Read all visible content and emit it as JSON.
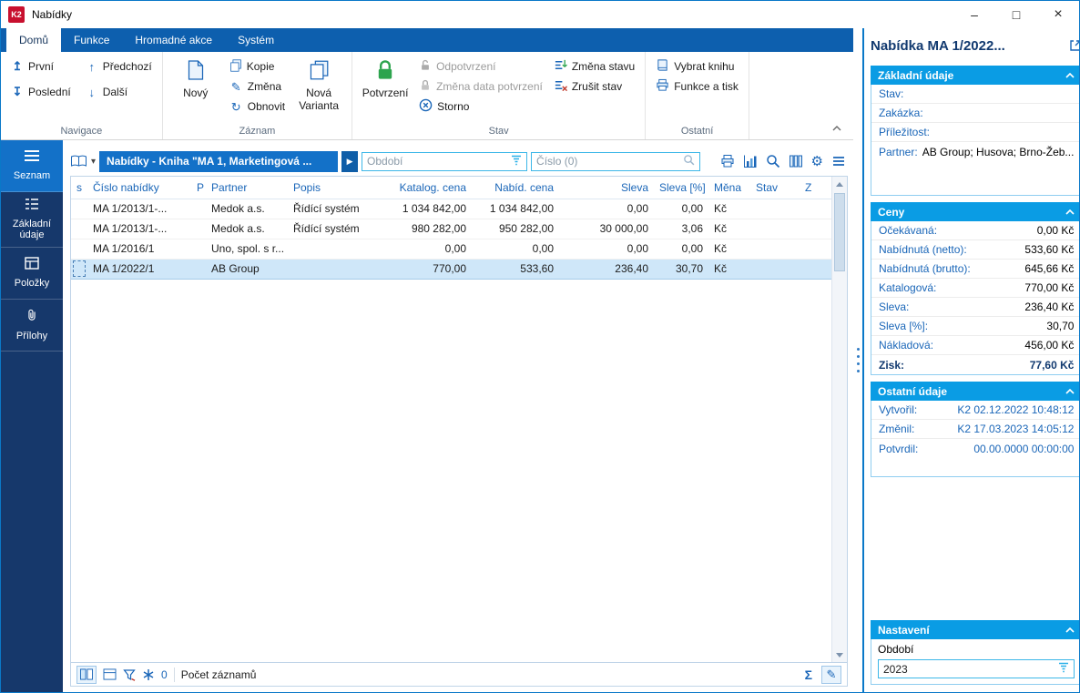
{
  "window": {
    "title": "Nabídky",
    "logo_text": "K2"
  },
  "icons": {
    "minimize": "–",
    "maximize": "□",
    "close": "×",
    "first_arrow": "↥",
    "prev_arrow": "↑",
    "last_arrow": "↧",
    "next_arrow": "↓",
    "refresh": "↻",
    "pencil": "✎",
    "play": "▶",
    "chevron_down": "▾",
    "gear": "⚙",
    "sum": "Σ"
  },
  "ribbon": {
    "tabs": [
      {
        "label": "Domů"
      },
      {
        "label": "Funkce"
      },
      {
        "label": "Hromadné akce"
      },
      {
        "label": "Systém"
      }
    ],
    "groups": {
      "navigace": {
        "label": "Navigace",
        "first": "První",
        "last": "Poslední",
        "prev": "Předchozí",
        "next": "Další"
      },
      "zaznam": {
        "label": "Záznam",
        "new": "Nový",
        "copy": "Kopie",
        "change": "Změna",
        "refresh": "Obnovit",
        "new_variant": "Nová Varianta"
      },
      "stav": {
        "label": "Stav",
        "confirm": "Potvrzení",
        "unconfirm": "Odpotvrzení",
        "change_confirm_date": "Změna data potvrzení",
        "storno": "Storno",
        "change_state": "Změna stavu",
        "cancel_state": "Zrušit stav"
      },
      "ostatni": {
        "label": "Ostatní",
        "select_book": "Vybrat knihu",
        "functions_print": "Funkce a tisk"
      }
    }
  },
  "sidebar": {
    "items": [
      {
        "label": "Seznam"
      },
      {
        "label": "Základní údaje"
      },
      {
        "label": "Položky"
      },
      {
        "label": "Přílohy"
      }
    ]
  },
  "grid": {
    "book_bar_title": "Nabídky - Kniha \"MA 1, Marketingová ...",
    "period_placeholder": "Období",
    "search_placeholder": "Číslo (0)",
    "columns": [
      "s",
      "Číslo nabídky",
      "P",
      "Partner",
      "Popis",
      "Katalog. cena",
      "Nabíd. cena",
      "Sleva",
      "Sleva [%]",
      "Měna",
      "Stav",
      "Z"
    ],
    "rows": [
      {
        "cells": [
          "",
          "MA 1/2013/1-...",
          "",
          "Medok a.s.",
          "Řídící systém",
          "1 034 842,00",
          "1 034 842,00",
          "0,00",
          "0,00",
          "Kč",
          "",
          ""
        ]
      },
      {
        "cells": [
          "",
          "MA 1/2013/1-...",
          "",
          "Medok a.s.",
          "Řídící systém",
          "980 282,00",
          "950 282,00",
          "30 000,00",
          "3,06",
          "Kč",
          "",
          ""
        ]
      },
      {
        "cells": [
          "",
          "MA 1/2016/1",
          "",
          "Uno, spol. s r...",
          "",
          "0,00",
          "0,00",
          "0,00",
          "0,00",
          "Kč",
          "",
          ""
        ]
      },
      {
        "cells": [
          "",
          "MA 1/2022/1",
          "",
          "AB Group",
          "",
          "770,00",
          "533,60",
          "236,40",
          "30,70",
          "Kč",
          "",
          ""
        ]
      }
    ],
    "status": {
      "task_count": "0",
      "count_label": "Počet záznamů"
    }
  },
  "panel": {
    "title": "Nabídka MA 1/2022...",
    "basic": {
      "title": "Základní údaje",
      "rows": [
        {
          "label": "Stav:",
          "value": ""
        },
        {
          "label": "Zakázka:",
          "value": ""
        },
        {
          "label": "Příležitost:",
          "value": ""
        },
        {
          "label": "Partner:",
          "value": "AB Group; Husova; Brno-Žeb..."
        }
      ]
    },
    "prices": {
      "title": "Ceny",
      "rows": [
        {
          "label": "Očekávaná:",
          "value": "0,00 Kč"
        },
        {
          "label": "Nabídnutá (netto):",
          "value": "533,60 Kč"
        },
        {
          "label": "Nabídnutá (brutto):",
          "value": "645,66 Kč"
        },
        {
          "label": "Katalogová:",
          "value": "770,00 Kč"
        },
        {
          "label": "Sleva:",
          "value": "236,40 Kč"
        },
        {
          "label": "Sleva [%]:",
          "value": "30,70"
        },
        {
          "label": "Nákladová:",
          "value": "456,00 Kč"
        },
        {
          "label": "Zisk:",
          "value": "77,60 Kč"
        }
      ]
    },
    "other": {
      "title": "Ostatní údaje",
      "rows": [
        {
          "label": "Vytvořil:",
          "value": "K2 02.12.2022 10:48:12"
        },
        {
          "label": "Změnil:",
          "value": "K2 17.03.2023 14:05:12"
        },
        {
          "label": "Potvrdil:",
          "value": "00.00.0000 00:00:00"
        }
      ]
    },
    "settings": {
      "title": "Nastavení",
      "period_label": "Období",
      "period_value": "2023"
    }
  }
}
